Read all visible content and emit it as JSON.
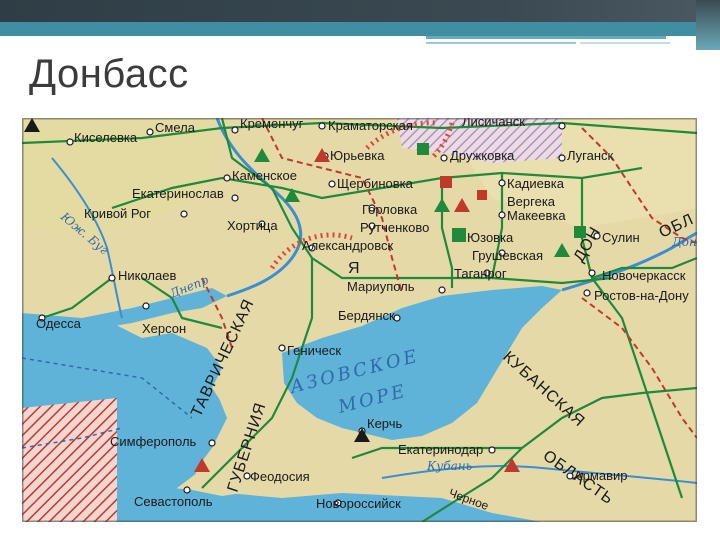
{
  "slide": {
    "title": "Донбасс"
  },
  "map": {
    "sea_labels": [
      "АЗОВСКОЕ",
      "МОРЕ"
    ],
    "region_labels": [
      "ТАВРИЧЕСКАЯ",
      "ГУБЕРНИЯ",
      "КУБАНСКАЯ",
      "ОБЛАСТЬ",
      "ОБЛ",
      "ДОН",
      "Я"
    ],
    "rivers": [
      "Днепр",
      "Юж. Буг",
      "Кубань",
      "Дон"
    ],
    "cities": [
      "Смела",
      "Кременчуг",
      "Краматорская",
      "Лисичанск",
      "Киселевка",
      "Юрьевка",
      "Дружковка",
      "Луганск",
      "Каменское",
      "Щербиновка",
      "Екатеринослав",
      "Кадиевка",
      "Вергека",
      "Кривой Рог",
      "Хортица",
      "Горловка",
      "Макеевка",
      "Рутченково",
      "Юзовка",
      "Сулин",
      "Александровск",
      "Грушевская",
      "Николаев",
      "Мариуполь",
      "Таганрог",
      "Новочеркасск",
      "Ростов-на-Дону",
      "Одесса",
      "Херсон",
      "Бердянск",
      "Геническ",
      "Керчь",
      "Симферополь",
      "Екатеринодар",
      "Феодосия",
      "Армавир",
      "Севастополь",
      "Новороссийск",
      "Черное"
    ]
  },
  "colors": {
    "topbar": "#2f3e46",
    "accent": "#3f8ea1",
    "sea": "#5fb3d8",
    "land": "#e6d9a8",
    "rail": "#1e8a3a",
    "border": "#c0392b",
    "donbass_hatch": "#b184c4"
  }
}
